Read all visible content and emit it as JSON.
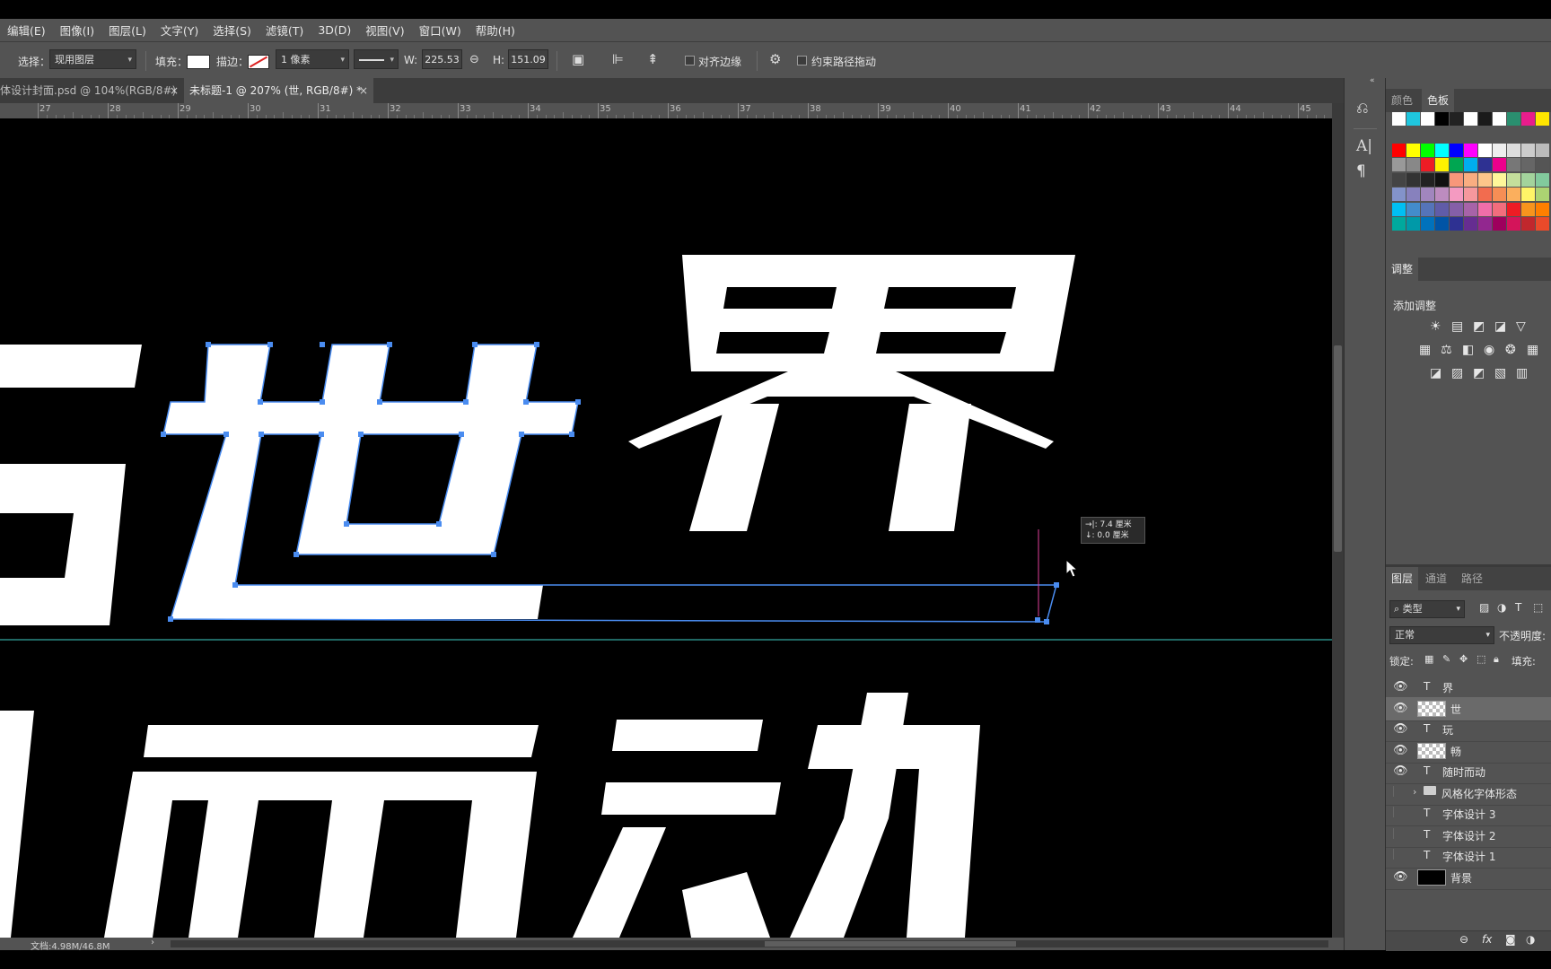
{
  "menu": [
    "编辑(E)",
    "图像(I)",
    "图层(L)",
    "文字(Y)",
    "选择(S)",
    "滤镜(T)",
    "3D(D)",
    "视图(V)",
    "窗口(W)",
    "帮助(H)"
  ],
  "options": {
    "select_label": "选择：",
    "select_value": "现用图层",
    "fill_label": "填充：",
    "stroke_label": "描边：",
    "stroke_width": "1 像素",
    "w_label": "W:",
    "w_value": "225.53",
    "h_label": "H:",
    "h_value": "151.09",
    "align_edges": "对齐边缘",
    "constrain_path": "约束路径拖动"
  },
  "tabs": [
    {
      "label": "体设计封面.psd @ 104%(RGB/8#)",
      "close": "×"
    },
    {
      "label": "未标题-1 @ 207% (世, RGB/8#) *",
      "close": "×"
    }
  ],
  "ruler_labels": [
    "27",
    "28",
    "29",
    "30",
    "31",
    "32",
    "33",
    "34",
    "35",
    "36",
    "37",
    "38",
    "39",
    "40",
    "41",
    "42",
    "43",
    "44",
    "45"
  ],
  "canvas": {
    "chars_row1": [
      "玩",
      "世",
      "界"
    ],
    "chars_row2": [
      "时",
      "而",
      "动"
    ],
    "tooltip_line1": "→|: 7.4 厘米",
    "tooltip_line2": "↓: 0.0 厘米"
  },
  "status": {
    "doc": "文档:4.98M/46.8M"
  },
  "panels": {
    "swatch_tabs": [
      "颜色",
      "色板"
    ],
    "adjust_tab": "调整",
    "adjust_title": "添加调整",
    "layers_tabs": [
      "图层",
      "通道",
      "路径"
    ],
    "filter_label": "类型",
    "blend_mode": "正常",
    "opacity_label": "不透明度:",
    "lock_label": "锁定:",
    "fill_label": "填充:",
    "layers": [
      {
        "name": "界",
        "kind": "text",
        "visible": true
      },
      {
        "name": "世",
        "kind": "shape",
        "visible": true,
        "selected": true
      },
      {
        "name": "玩",
        "kind": "text",
        "visible": true
      },
      {
        "name": "畅",
        "kind": "shape",
        "visible": true
      },
      {
        "name": "随时而动",
        "kind": "text",
        "visible": true
      },
      {
        "name": "风格化字体形态",
        "kind": "group",
        "visible": false
      },
      {
        "name": "字体设计 3",
        "kind": "text",
        "visible": false
      },
      {
        "name": "字体设计 2",
        "kind": "text",
        "visible": false
      },
      {
        "name": "字体设计 1",
        "kind": "text",
        "visible": false
      },
      {
        "name": "背景",
        "kind": "fill",
        "visible": true
      }
    ]
  },
  "colors": {
    "ui_dark": "#535353",
    "path_blue": "#4a8cf0",
    "guide": "#3fd0c8",
    "smart_guide": "#e0409a"
  }
}
